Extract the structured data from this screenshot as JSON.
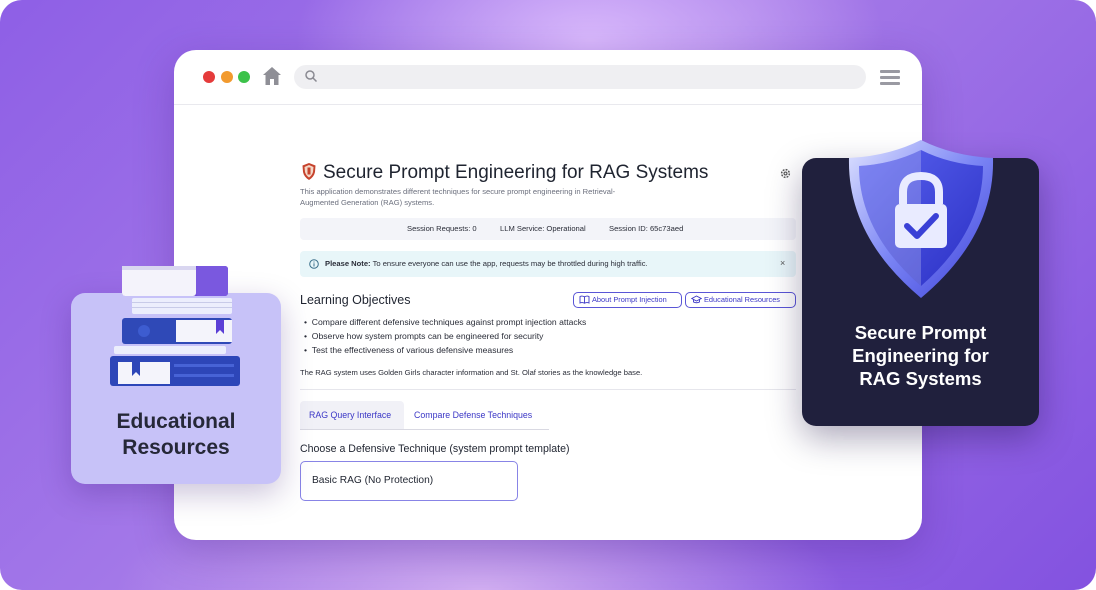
{
  "browser": {
    "url": ""
  },
  "app": {
    "title": "Secure Prompt Engineering for RAG Systems",
    "description": "This application demonstrates different techniques for secure prompt engineering in Retrieval-Augmented Generation (RAG) systems.",
    "status": {
      "session_requests": "Session Requests: 0",
      "llm_service": "LLM Service: Operational",
      "session_id": "Session ID: 65c73aed"
    },
    "note": {
      "label": "Please Note:",
      "text": " To ensure everyone can use the app, requests may be throttled during high traffic.",
      "close": "×"
    },
    "learning": {
      "title": "Learning Objectives",
      "buttons": [
        "About Prompt Injection",
        "Educational Resources"
      ],
      "objectives": [
        "Compare different defensive techniques against prompt injection attacks",
        "Observe how system prompts can be engineered for security",
        "Test the effectiveness of various defensive measures"
      ],
      "kb_text": "The RAG system uses Golden Girls character information and St. Olaf stories as the knowledge base."
    },
    "tabs": [
      "RAG Query Interface",
      "Compare Defense Techniques"
    ],
    "technique": {
      "label": "Choose a Defensive Technique (system prompt template)",
      "selected": "Basic RAG (No Protection)"
    }
  },
  "cards": {
    "left_line1": "Educational",
    "left_line2": "Resources",
    "right_line1": "Secure Prompt",
    "right_line2": "Engineering for",
    "right_line3": "RAG Systems"
  },
  "colors": {
    "accent": "#3b37c6",
    "background": "#8e5fe6",
    "card_left": "#c7c2f8",
    "card_right": "#20203d"
  }
}
